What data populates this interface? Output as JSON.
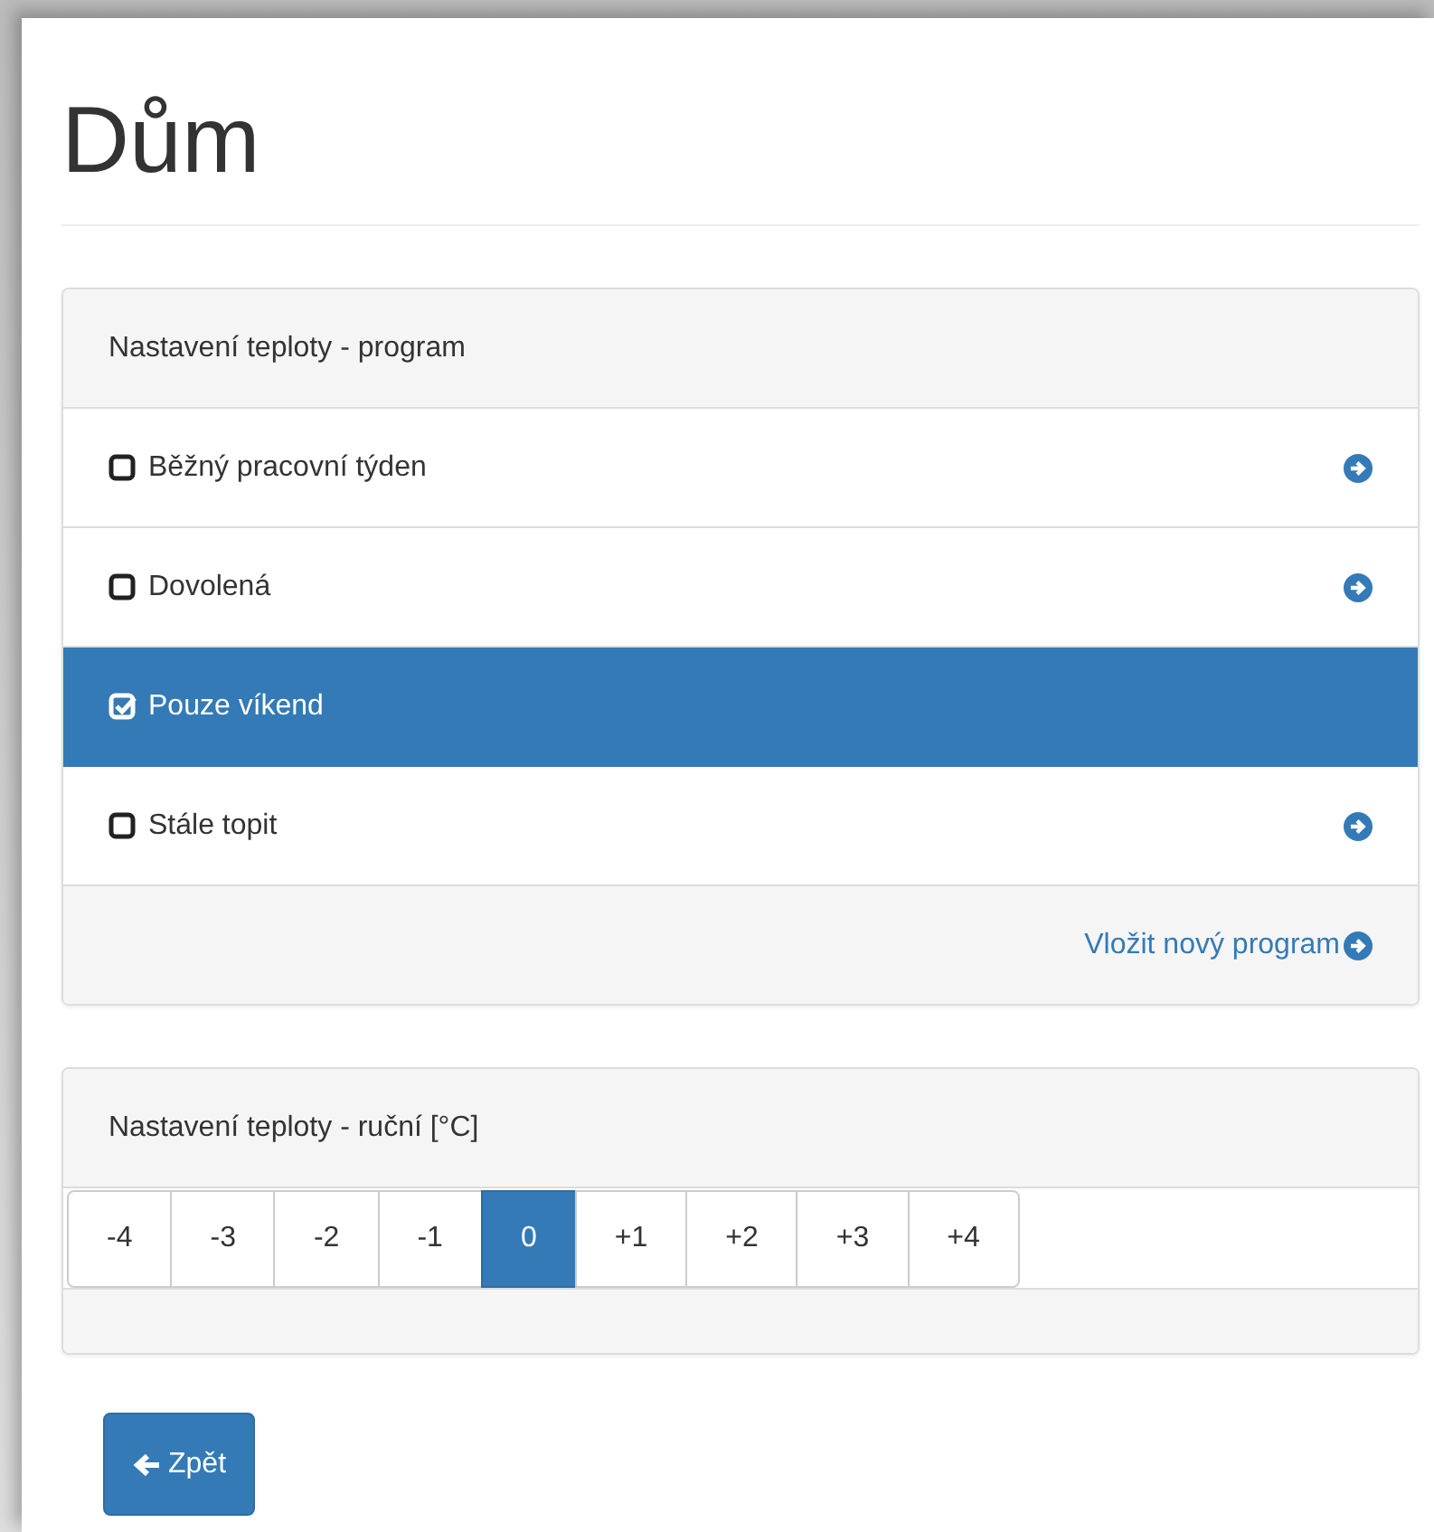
{
  "title": "Dům",
  "program_panel": {
    "heading": "Nastavení teploty - program",
    "items": [
      {
        "label": "Běžný pracovní týden",
        "selected": false
      },
      {
        "label": "Dovolená",
        "selected": false
      },
      {
        "label": "Pouze víkend",
        "selected": true
      },
      {
        "label": "Stále topit",
        "selected": false
      }
    ],
    "footer_link": "Vložit nový program"
  },
  "manual_panel": {
    "heading": "Nastavení teploty - ruční [°C]",
    "options": [
      {
        "label": "-4",
        "selected": false
      },
      {
        "label": "-3",
        "selected": false
      },
      {
        "label": "-2",
        "selected": false
      },
      {
        "label": "-1",
        "selected": false
      },
      {
        "label": "0",
        "selected": true
      },
      {
        "label": "+1",
        "selected": false
      },
      {
        "label": "+2",
        "selected": false
      },
      {
        "label": "+3",
        "selected": false
      },
      {
        "label": "+4",
        "selected": false
      }
    ]
  },
  "back_button": "Zpět"
}
